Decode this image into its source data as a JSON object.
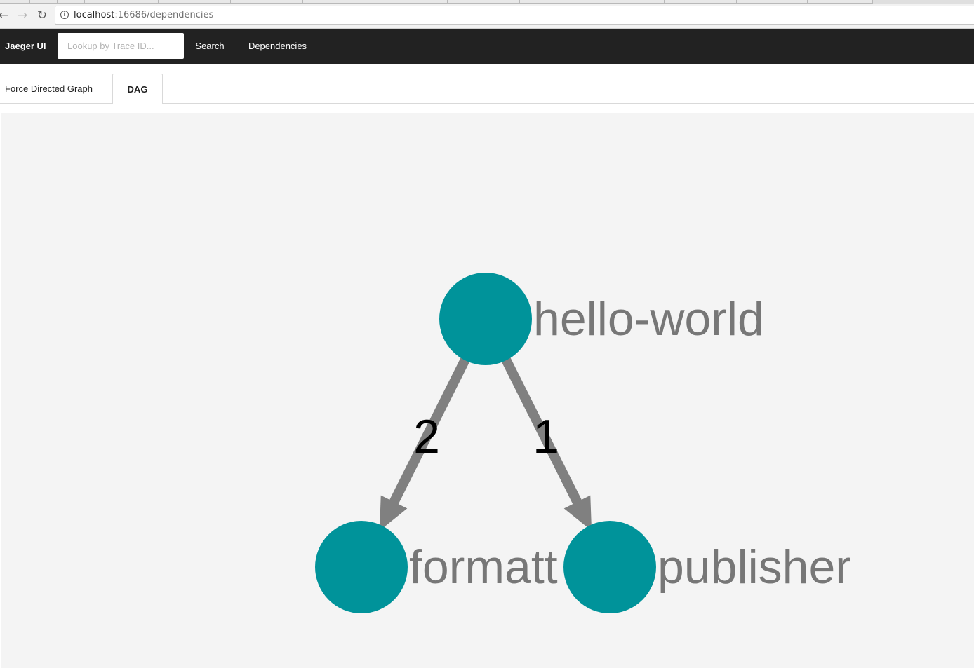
{
  "browser": {
    "url_host": "localhost",
    "url_path": ":16686/dependencies"
  },
  "nav": {
    "brand": "Jaeger UI",
    "lookup_placeholder": "Lookup by Trace ID...",
    "search_label": "Search",
    "dependencies_label": "Dependencies"
  },
  "tabs": {
    "force_label": "Force Directed Graph",
    "dag_label": "DAG"
  },
  "graph": {
    "node_color": "#00939a",
    "edge_color": "#808080",
    "label_color": "#777777",
    "nodes": [
      {
        "id": "hello-world",
        "label": "hello-world"
      },
      {
        "id": "formatter",
        "label": "formatt"
      },
      {
        "id": "publisher",
        "label": "publisher"
      }
    ],
    "edges": [
      {
        "from": "hello-world",
        "to": "formatter",
        "label": "2"
      },
      {
        "from": "hello-world",
        "to": "publisher",
        "label": "1"
      }
    ]
  }
}
